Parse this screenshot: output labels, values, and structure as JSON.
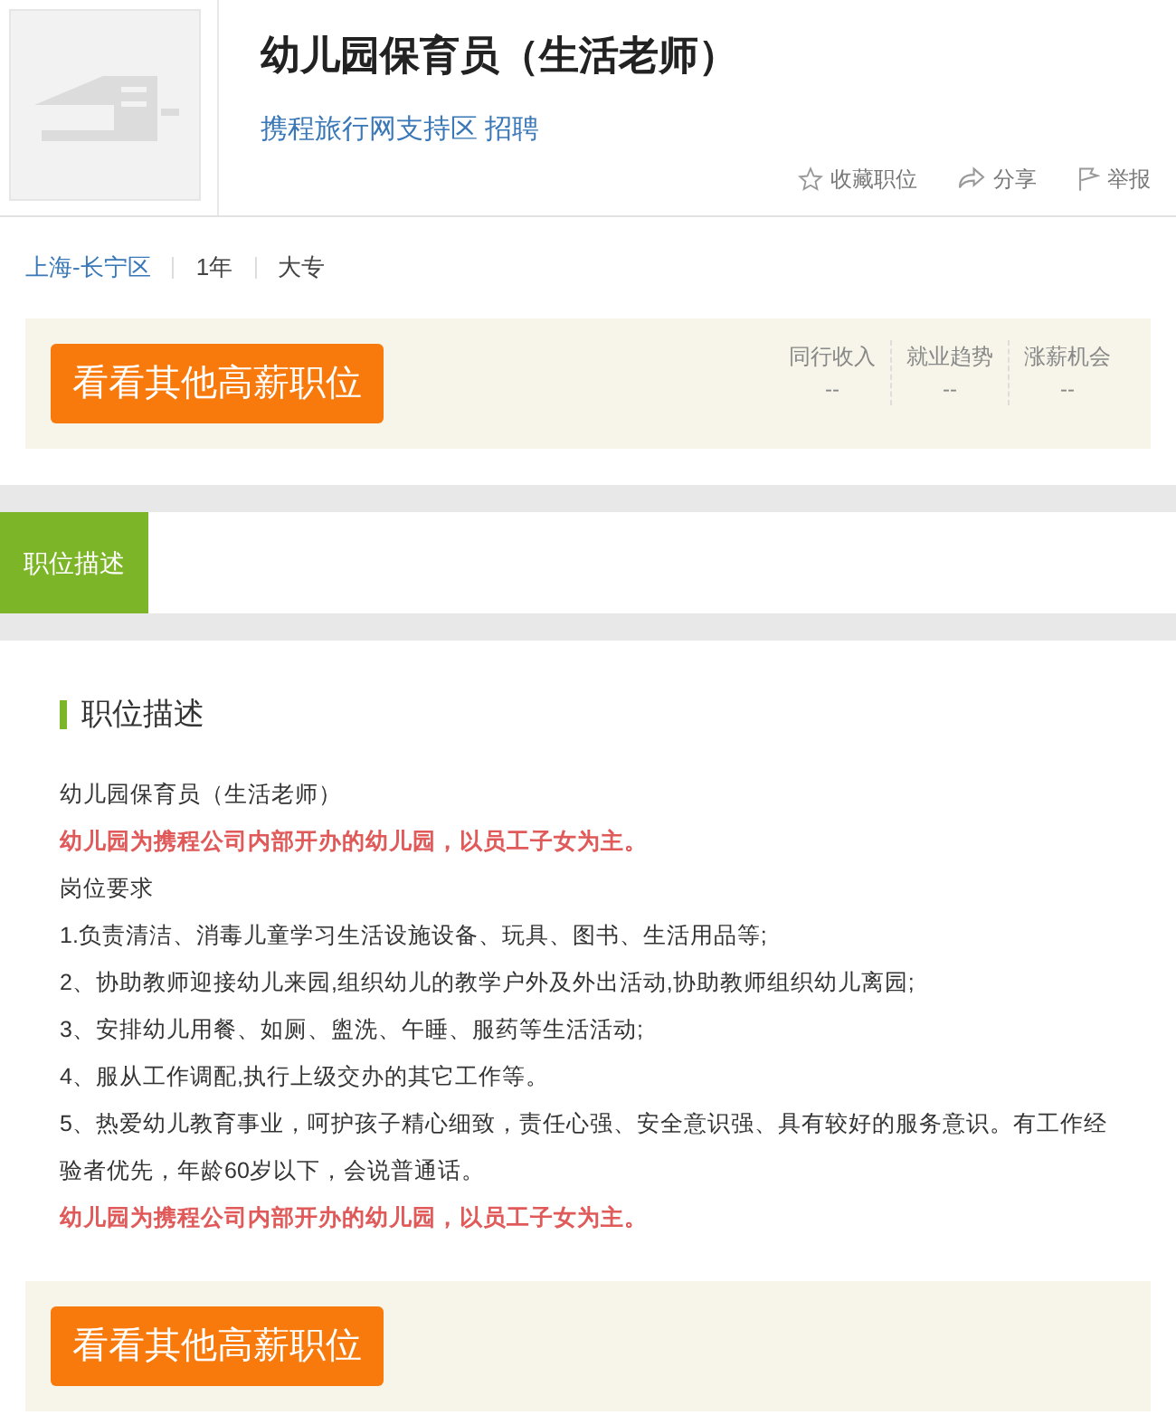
{
  "job": {
    "title": "幼儿园保育员（生活老师）",
    "company": "携程旅行网支持区 招聘"
  },
  "actions": [
    {
      "kind": "star",
      "label": "收藏职位"
    },
    {
      "kind": "share",
      "label": "分享"
    },
    {
      "kind": "flag",
      "label": "举报"
    }
  ],
  "meta": [
    {
      "label": "上海-长宁区",
      "kind": "link"
    },
    {
      "label": "1年",
      "kind": "text"
    },
    {
      "label": "大专",
      "kind": "text"
    }
  ],
  "promo_top": {
    "button": "看看其他高薪职位",
    "stats": [
      {
        "label": "同行收入",
        "value": "--"
      },
      {
        "label": "就业趋势",
        "value": "--"
      },
      {
        "label": "涨薪机会",
        "value": "--"
      }
    ]
  },
  "tabs": [
    {
      "label": "职位描述",
      "selected": true
    }
  ],
  "section": {
    "heading": "职位描述",
    "lines": [
      {
        "kind": "text",
        "text": "幼儿园保育员（生活老师）"
      },
      {
        "kind": "highlight",
        "text": "幼儿园为携程公司内部开办的幼儿园，以员工子女为主。"
      },
      {
        "kind": "text",
        "text": "岗位要求"
      },
      {
        "kind": "text",
        "text": "1.负责清洁、消毒儿童学习生活设施设备、玩具、图书、生活用品等;"
      },
      {
        "kind": "text",
        "text": "2、协助教师迎接幼儿来园,组织幼儿的教学户外及外出活动,协助教师组织幼儿离园;"
      },
      {
        "kind": "text",
        "text": "3、安排幼儿用餐、如厕、盥洗、午睡、服药等生活活动;"
      },
      {
        "kind": "text",
        "text": "4、服从工作调配,执行上级交办的其它工作等。"
      },
      {
        "kind": "text",
        "text": "5、热爱幼儿教育事业，呵护孩子精心细致，责任心强、安全意识强、具有较好的服务意识。有工作经验者优先，年龄60岁以下，会说普通话。"
      },
      {
        "kind": "highlight",
        "text": "幼儿园为携程公司内部开办的幼儿园，以员工子女为主。"
      }
    ]
  },
  "promo_bottom": {
    "button": "看看其他高薪职位"
  }
}
